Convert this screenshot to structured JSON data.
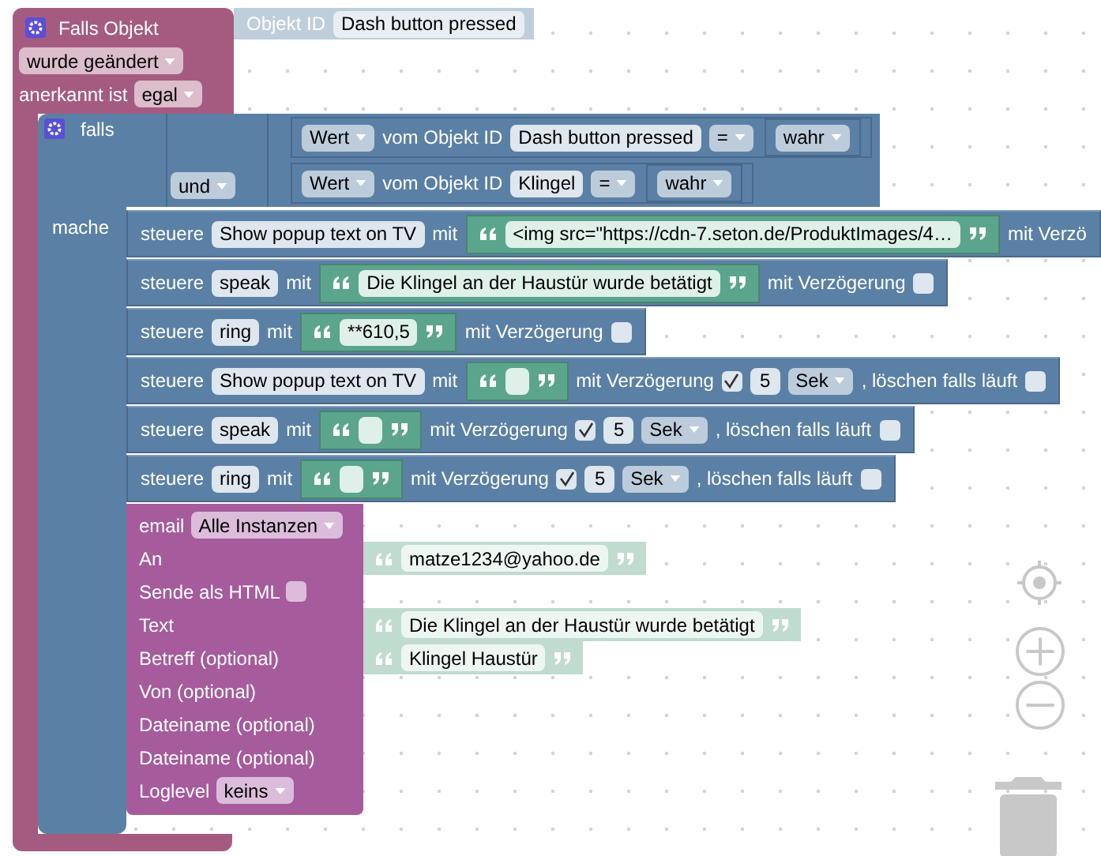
{
  "trigger": {
    "title": "Falls Objekt",
    "object_label": "Objekt ID",
    "object_id": "Dash button pressed",
    "event": "wurde geändert",
    "ack_label": "anerkannt ist",
    "ack": "egal"
  },
  "if_block": {
    "label": "falls",
    "do_label": "mache",
    "logic": "und",
    "conditions": [
      {
        "field": "Wert",
        "label": "vom Objekt ID",
        "object_id": "Dash button pressed",
        "op": "=",
        "value": "wahr"
      },
      {
        "field": "Wert",
        "label": "vom Objekt ID",
        "object_id": "Klingel",
        "op": "=",
        "value": "wahr"
      }
    ]
  },
  "statements": [
    {
      "label": "steuere",
      "target": "Show popup text on TV",
      "with": "mit",
      "text": "<img src=\"https://cdn-7.seton.de/ProduktImages/4…",
      "delay_label": "mit Verzö"
    },
    {
      "label": "steuere",
      "target": "speak",
      "with": "mit",
      "text": "Die Klingel an der Haustür wurde betätigt",
      "delay_label": "mit Verzögerung",
      "delay": false
    },
    {
      "label": "steuere",
      "target": "ring",
      "with": "mit",
      "text": "**610,5",
      "delay_label": "mit Verzögerung",
      "delay": false
    },
    {
      "label": "steuere",
      "target": "Show popup text on TV",
      "with": "mit",
      "delay_label": "mit Verzögerung",
      "delay": true,
      "delay_value": "5",
      "unit": "Sek",
      "clear_label": ", löschen falls läuft",
      "clear": false
    },
    {
      "label": "steuere",
      "target": "speak",
      "with": "mit",
      "delay_label": "mit Verzögerung",
      "delay": true,
      "delay_value": "5",
      "unit": "Sek",
      "clear_label": ", löschen falls läuft",
      "clear": false
    },
    {
      "label": "steuere",
      "target": "ring",
      "with": "mit",
      "delay_label": "mit Verzögerung",
      "delay": true,
      "delay_value": "5",
      "unit": "Sek",
      "clear_label": ", löschen falls läuft",
      "clear": false
    }
  ],
  "email": {
    "label": "email",
    "instance": "Alle Instanzen",
    "rows": [
      {
        "kind": "input",
        "label": "An",
        "value": "matze1234@yahoo.de"
      },
      {
        "kind": "checkbox",
        "label": "Sende als HTML",
        "checked": false
      },
      {
        "kind": "input",
        "label": "Text",
        "value": "Die Klingel an der Haustür wurde betätigt"
      },
      {
        "kind": "input",
        "label": "Betreff (optional)",
        "value": "Klingel Haustür"
      },
      {
        "kind": "input",
        "label": "Von (optional)"
      },
      {
        "kind": "input",
        "label": "Dateiname (optional)"
      },
      {
        "kind": "input",
        "label": "Dateiname (optional)"
      },
      {
        "kind": "dropdown",
        "label": "Loglevel",
        "value": "keins"
      }
    ]
  }
}
